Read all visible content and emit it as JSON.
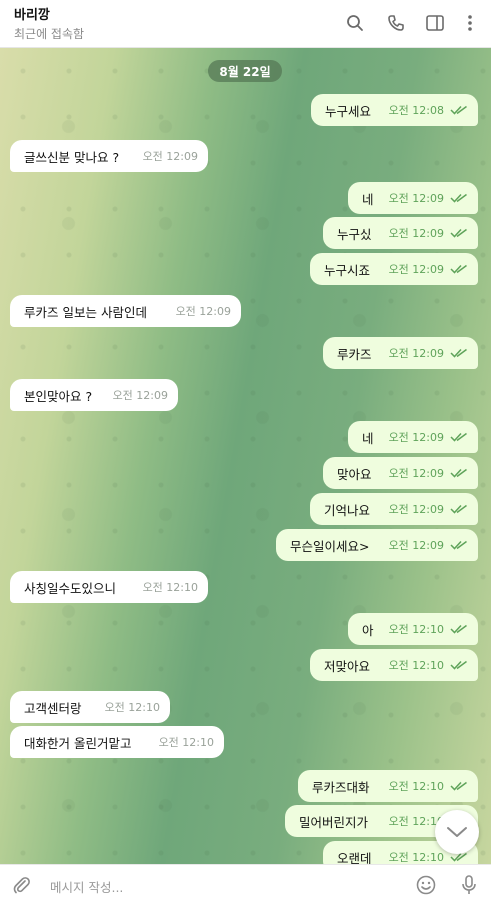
{
  "header": {
    "name": "바리깡",
    "status": "최근에 접속함"
  },
  "date_label": "8월 22일",
  "messages": [
    {
      "dir": "out",
      "text": "누구세요",
      "time": "오전 12:08"
    },
    {
      "dir": "in",
      "text": "글쓰신분 맞나요 ?",
      "time": "오전 12:09"
    },
    {
      "dir": "out",
      "text": "네",
      "time": "오전 12:09"
    },
    {
      "dir": "out",
      "text": "누구싰",
      "time": "오전 12:09"
    },
    {
      "dir": "out",
      "text": "누구시죠",
      "time": "오전 12:09"
    },
    {
      "dir": "in",
      "text": "루카즈 일보는 사람인데",
      "time": "오전 12:09"
    },
    {
      "dir": "out",
      "text": "루카즈",
      "time": "오전 12:09"
    },
    {
      "dir": "in",
      "text": "본인맞아요 ?",
      "time": "오전 12:09"
    },
    {
      "dir": "out",
      "text": "네",
      "time": "오전 12:09"
    },
    {
      "dir": "out",
      "text": "맞아요",
      "time": "오전 12:09"
    },
    {
      "dir": "out",
      "text": "기억나요",
      "time": "오전 12:09"
    },
    {
      "dir": "out",
      "text": "무슨일이세요>",
      "time": "오전 12:09"
    },
    {
      "dir": "in",
      "text": "사칭일수도있으니",
      "time": "오전 12:10"
    },
    {
      "dir": "out",
      "text": "아",
      "time": "오전 12:10"
    },
    {
      "dir": "out",
      "text": "저맞아요",
      "time": "오전 12:10"
    },
    {
      "dir": "in",
      "text": "고객센터랑",
      "time": "오전 12:10"
    },
    {
      "dir": "in",
      "text": "대화한거 올린거맡고",
      "time": "오전 12:10"
    },
    {
      "dir": "out",
      "text": "루카즈대화",
      "time": "오전 12:10"
    },
    {
      "dir": "out",
      "text": "밀어버린지가",
      "time": "오전 12:10"
    },
    {
      "dir": "out",
      "text": "오랜데",
      "time": "오전 12:10"
    }
  ],
  "composer": {
    "placeholder": "메시지 작성..."
  },
  "colors": {
    "outgoing_bubble": "#effdde",
    "incoming_bubble": "#ffffff",
    "check": "#5fa35a"
  },
  "icons": [
    "search-icon",
    "phone-icon",
    "sidebar-icon",
    "more-icon",
    "attach-icon",
    "emoji-icon",
    "mic-icon",
    "chevron-down-icon"
  ]
}
